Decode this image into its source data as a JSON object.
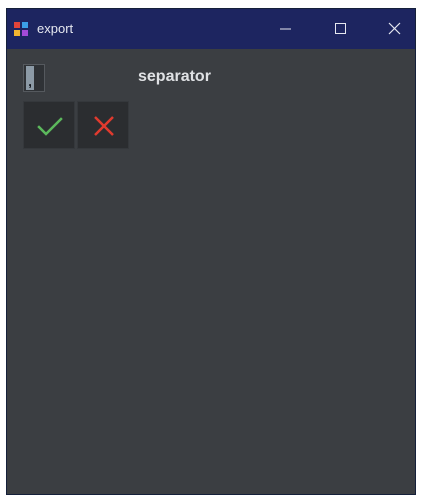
{
  "window": {
    "title": "export",
    "icon": "app-grid-icon",
    "controls": {
      "minimize_icon": "minimize-icon",
      "maximize_icon": "maximize-icon",
      "close_icon": "close-icon"
    }
  },
  "form": {
    "separator_value": ",",
    "separator_label": "separator"
  },
  "actions": {
    "confirm_icon": "checkmark-icon",
    "confirm_color": "#5cb85c",
    "cancel_icon": "cross-icon",
    "cancel_color": "#e03a2e"
  },
  "colors": {
    "titlebar": "#1d2560",
    "background": "#3b3e42"
  }
}
